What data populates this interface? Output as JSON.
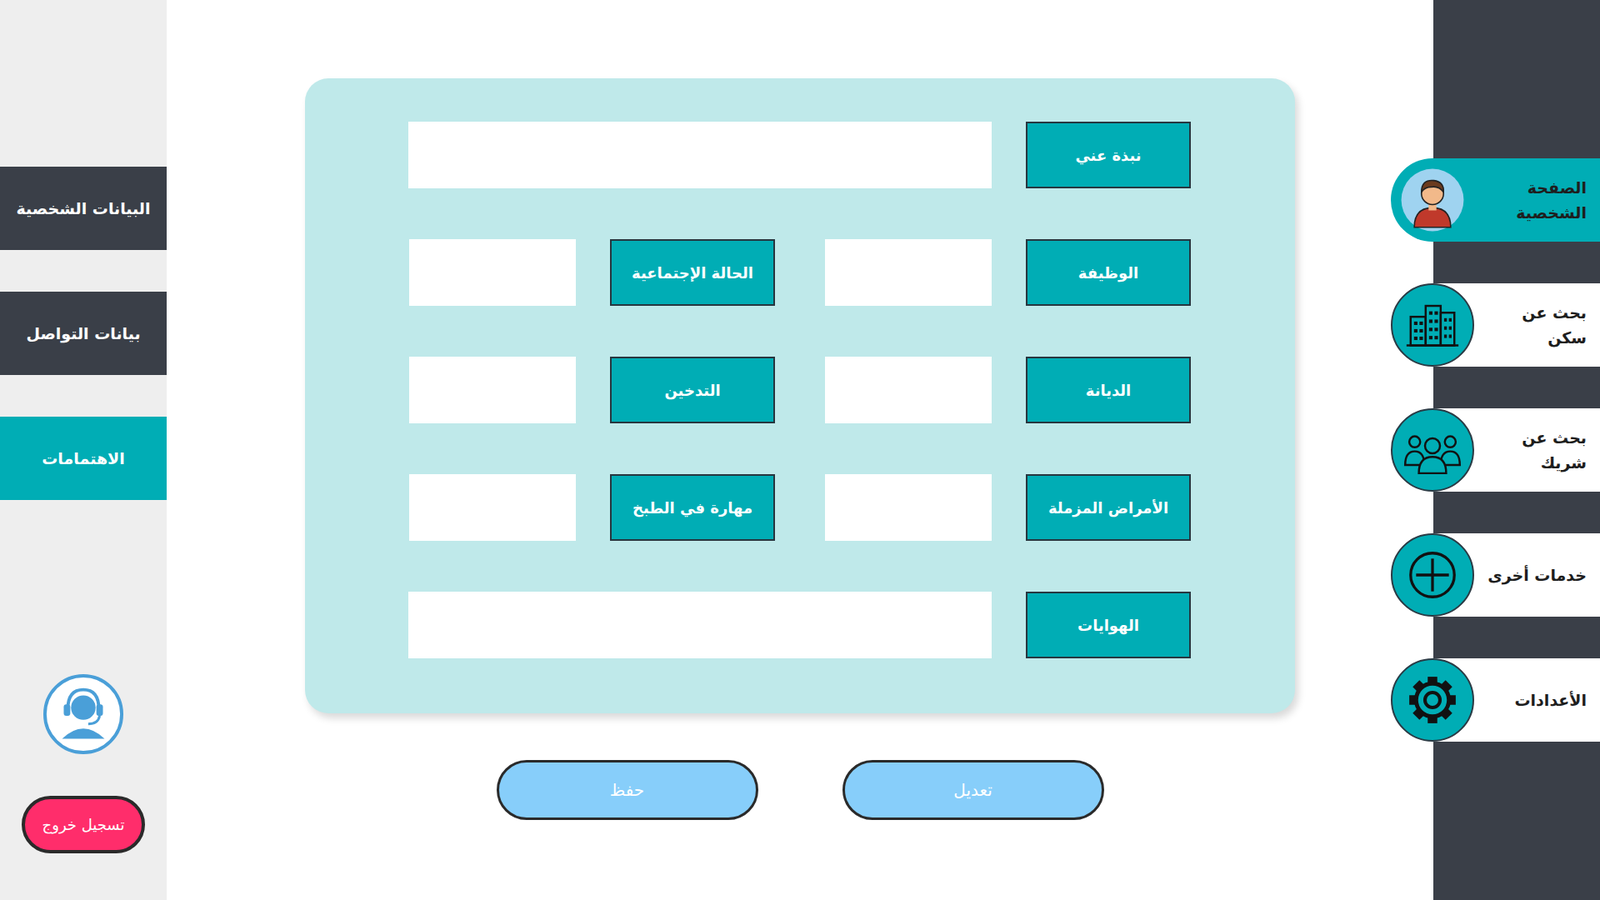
{
  "nav": [
    {
      "label": "الصفحة الشخصية",
      "selected": true,
      "kind": "profile"
    },
    {
      "label": "بحث عن سكن",
      "selected": false,
      "kind": "housing"
    },
    {
      "label": "بحث عن شريك",
      "selected": false,
      "kind": "partner"
    },
    {
      "label": "خدمات أخرى",
      "selected": false,
      "kind": "services"
    },
    {
      "label": "الأعدادات",
      "selected": false,
      "kind": "settings"
    }
  ],
  "tabs": [
    {
      "label": "البيانات الشخصية",
      "selected": false
    },
    {
      "label": "بيانات التواصل",
      "selected": false
    },
    {
      "label": "الاهتمامات",
      "selected": true
    }
  ],
  "form": {
    "rows": [
      [
        {
          "label": "نبذة عني",
          "value": "",
          "kind": "wide"
        }
      ],
      [
        {
          "label": "الوظيفة",
          "value": "",
          "kind": "half"
        },
        {
          "label": "الحالة الإجتماعية",
          "value": "",
          "kind": "half"
        }
      ],
      [
        {
          "label": "الديانة",
          "value": "",
          "kind": "half"
        },
        {
          "label": "التدخين",
          "value": "",
          "kind": "half"
        }
      ],
      [
        {
          "label": "الأمراض المزملة",
          "value": "",
          "kind": "half"
        },
        {
          "label": "مهارة في الطبخ",
          "value": "",
          "kind": "half"
        }
      ],
      [
        {
          "label": "الهوايات",
          "value": "",
          "kind": "wide"
        }
      ]
    ]
  },
  "buttons": [
    {
      "label": "تعديل"
    },
    {
      "label": "حفظ"
    }
  ],
  "logout": "تسجيل خروج"
}
